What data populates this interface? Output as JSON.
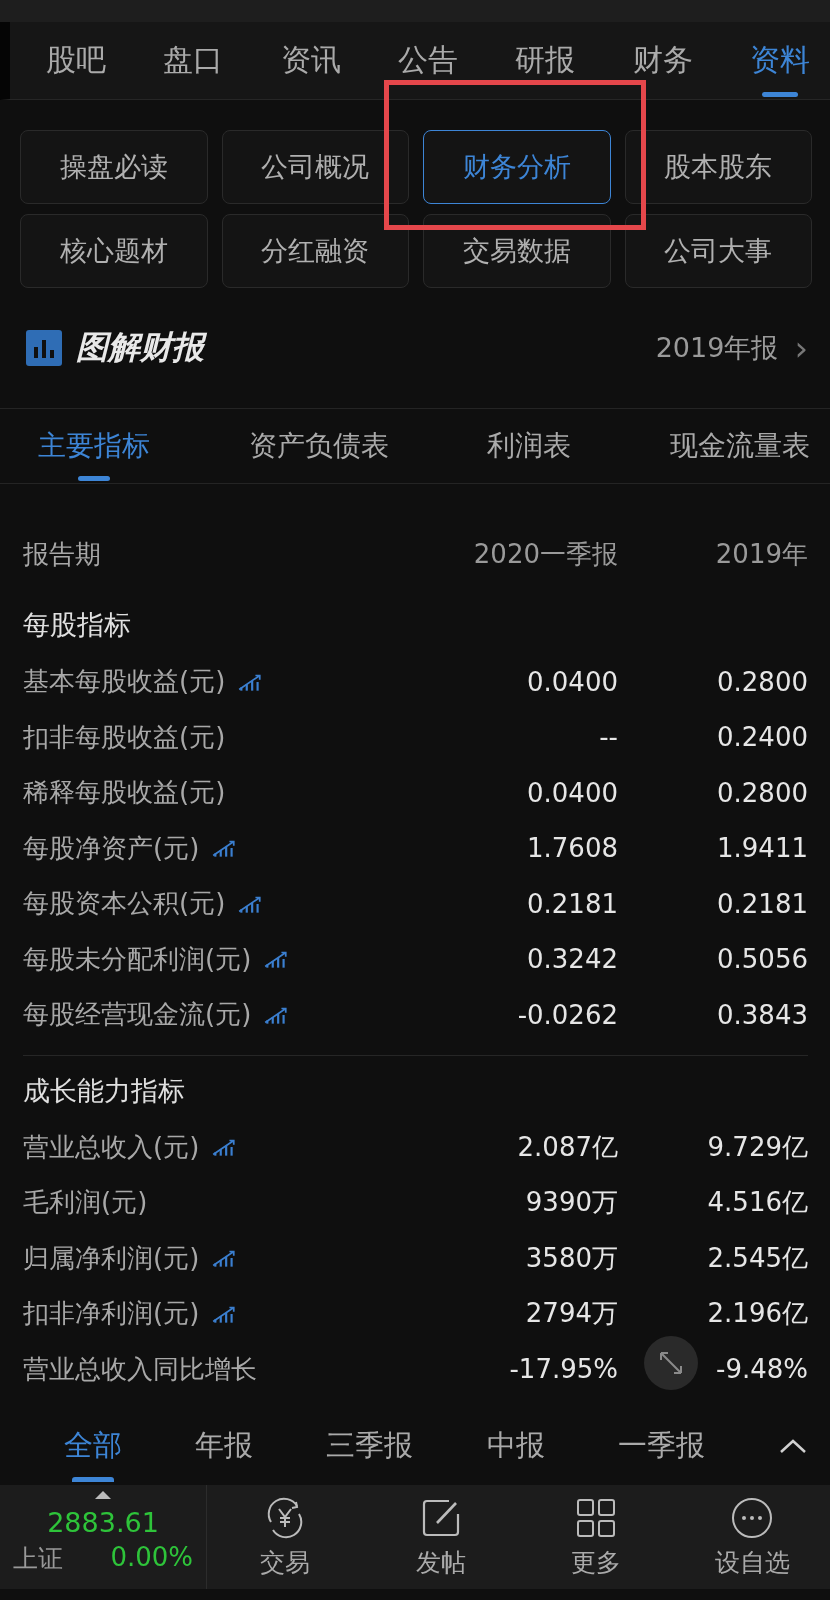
{
  "top_tabs": [
    {
      "label": "股吧",
      "selected": false
    },
    {
      "label": "盘口",
      "selected": false
    },
    {
      "label": "资讯",
      "selected": false
    },
    {
      "label": "公告",
      "selected": false
    },
    {
      "label": "研报",
      "selected": false
    },
    {
      "label": "财务",
      "selected": false
    },
    {
      "label": "资料",
      "selected": true
    }
  ],
  "sections": [
    {
      "label": "操盘必读",
      "selected": false
    },
    {
      "label": "公司概况",
      "selected": false
    },
    {
      "label": "财务分析",
      "selected": true
    },
    {
      "label": "股本股东",
      "selected": false
    },
    {
      "label": "核心题材",
      "selected": false
    },
    {
      "label": "分红融资",
      "selected": false
    },
    {
      "label": "交易数据",
      "selected": false
    },
    {
      "label": "公司大事",
      "selected": false
    }
  ],
  "report_header": {
    "title": "图解财报",
    "period": "2019年报",
    "chevron": "›"
  },
  "sub_tabs": [
    {
      "label": "主要指标",
      "selected": true
    },
    {
      "label": "资产负债表",
      "selected": false
    },
    {
      "label": "利润表",
      "selected": false
    },
    {
      "label": "现金流量表",
      "selected": false
    }
  ],
  "table": {
    "columns": [
      "报告期",
      "2020一季报",
      "2019年"
    ],
    "groups": [
      {
        "title": "每股指标",
        "rows": [
          {
            "label": "基本每股收益(元)",
            "trend": true,
            "values": [
              "0.0400",
              "0.2800"
            ]
          },
          {
            "label": "扣非每股收益(元)",
            "trend": false,
            "values": [
              "--",
              "0.2400"
            ]
          },
          {
            "label": "稀释每股收益(元)",
            "trend": false,
            "values": [
              "0.0400",
              "0.2800"
            ]
          },
          {
            "label": "每股净资产(元)",
            "trend": true,
            "values": [
              "1.7608",
              "1.9411"
            ]
          },
          {
            "label": "每股资本公积(元)",
            "trend": true,
            "values": [
              "0.2181",
              "0.2181"
            ]
          },
          {
            "label": "每股未分配利润(元)",
            "trend": true,
            "values": [
              "0.3242",
              "0.5056"
            ]
          },
          {
            "label": "每股经营现金流(元)",
            "trend": true,
            "values": [
              "-0.0262",
              "0.3843"
            ]
          }
        ]
      },
      {
        "title": "成长能力指标",
        "rows": [
          {
            "label": "营业总收入(元)",
            "trend": true,
            "values": [
              "2.087亿",
              "9.729亿"
            ]
          },
          {
            "label": "毛利润(元)",
            "trend": false,
            "values": [
              "9390万",
              "4.516亿"
            ]
          },
          {
            "label": "归属净利润(元)",
            "trend": true,
            "values": [
              "3580万",
              "2.545亿"
            ]
          },
          {
            "label": "扣非净利润(元)",
            "trend": true,
            "values": [
              "2794万",
              "2.196亿"
            ]
          },
          {
            "label": "营业总收入同比增长",
            "trend": false,
            "values": [
              "-17.95%",
              "-9.48%"
            ]
          }
        ]
      }
    ]
  },
  "period_filter": {
    "options": [
      {
        "label": "全部",
        "selected": true
      },
      {
        "label": "年报",
        "selected": false
      },
      {
        "label": "三季报",
        "selected": false
      },
      {
        "label": "中报",
        "selected": false
      },
      {
        "label": "一季报",
        "selected": false
      }
    ]
  },
  "index_quote": {
    "value": "2883.61",
    "name": "上证",
    "change": "0.00%"
  },
  "bottom_nav": [
    {
      "label": "交易",
      "kind": "trade"
    },
    {
      "label": "发帖",
      "kind": "post"
    },
    {
      "label": "更多",
      "kind": "more"
    },
    {
      "label": "设自选",
      "kind": "watch"
    }
  ]
}
